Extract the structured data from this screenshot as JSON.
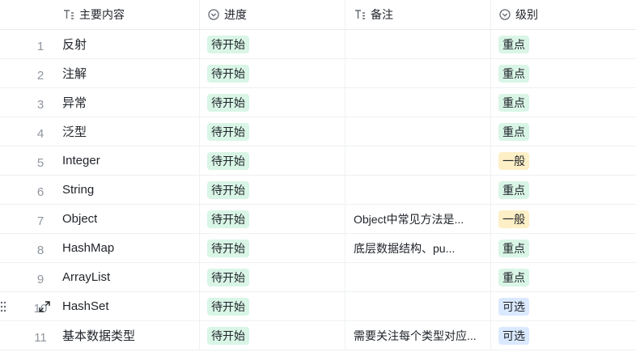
{
  "columns": {
    "main": "主要内容",
    "progress": "进度",
    "note": "备注",
    "level": "级别"
  },
  "icons": {
    "main_col": "text-field-icon",
    "progress_col": "single-select-icon",
    "note_col": "text-field-icon",
    "level_col": "single-select-icon",
    "expand": "expand-icon",
    "drag": "drag-handle-icon"
  },
  "tag_colors": {
    "green": "#d9f5e6",
    "yellow": "#fdefc6",
    "blue": "#dbe9ff"
  },
  "rows": [
    {
      "index": "1",
      "main": "反射",
      "progress": "待开始",
      "note": "",
      "level": "重点"
    },
    {
      "index": "2",
      "main": "注解",
      "progress": "待开始",
      "note": "",
      "level": "重点"
    },
    {
      "index": "3",
      "main": "异常",
      "progress": "待开始",
      "note": "",
      "level": "重点"
    },
    {
      "index": "4",
      "main": "泛型",
      "progress": "待开始",
      "note": "",
      "level": "重点"
    },
    {
      "index": "5",
      "main": "Integer",
      "progress": "待开始",
      "note": "",
      "level": "一般"
    },
    {
      "index": "6",
      "main": "String",
      "progress": "待开始",
      "note": "",
      "level": "重点"
    },
    {
      "index": "7",
      "main": "Object",
      "progress": "待开始",
      "note": "Object中常见方法是...",
      "level": "一般"
    },
    {
      "index": "8",
      "main": "HashMap",
      "progress": "待开始",
      "note": "底层数据结构、pu...",
      "level": "重点"
    },
    {
      "index": "9",
      "main": "ArrayList",
      "progress": "待开始",
      "note": "",
      "level": "重点"
    },
    {
      "index": "10",
      "main": "HashSet",
      "progress": "待开始",
      "note": "",
      "level": "可选"
    },
    {
      "index": "11",
      "main": "基本数据类型",
      "progress": "待开始",
      "note": "需要关注每个类型对应...",
      "level": "可选"
    }
  ]
}
